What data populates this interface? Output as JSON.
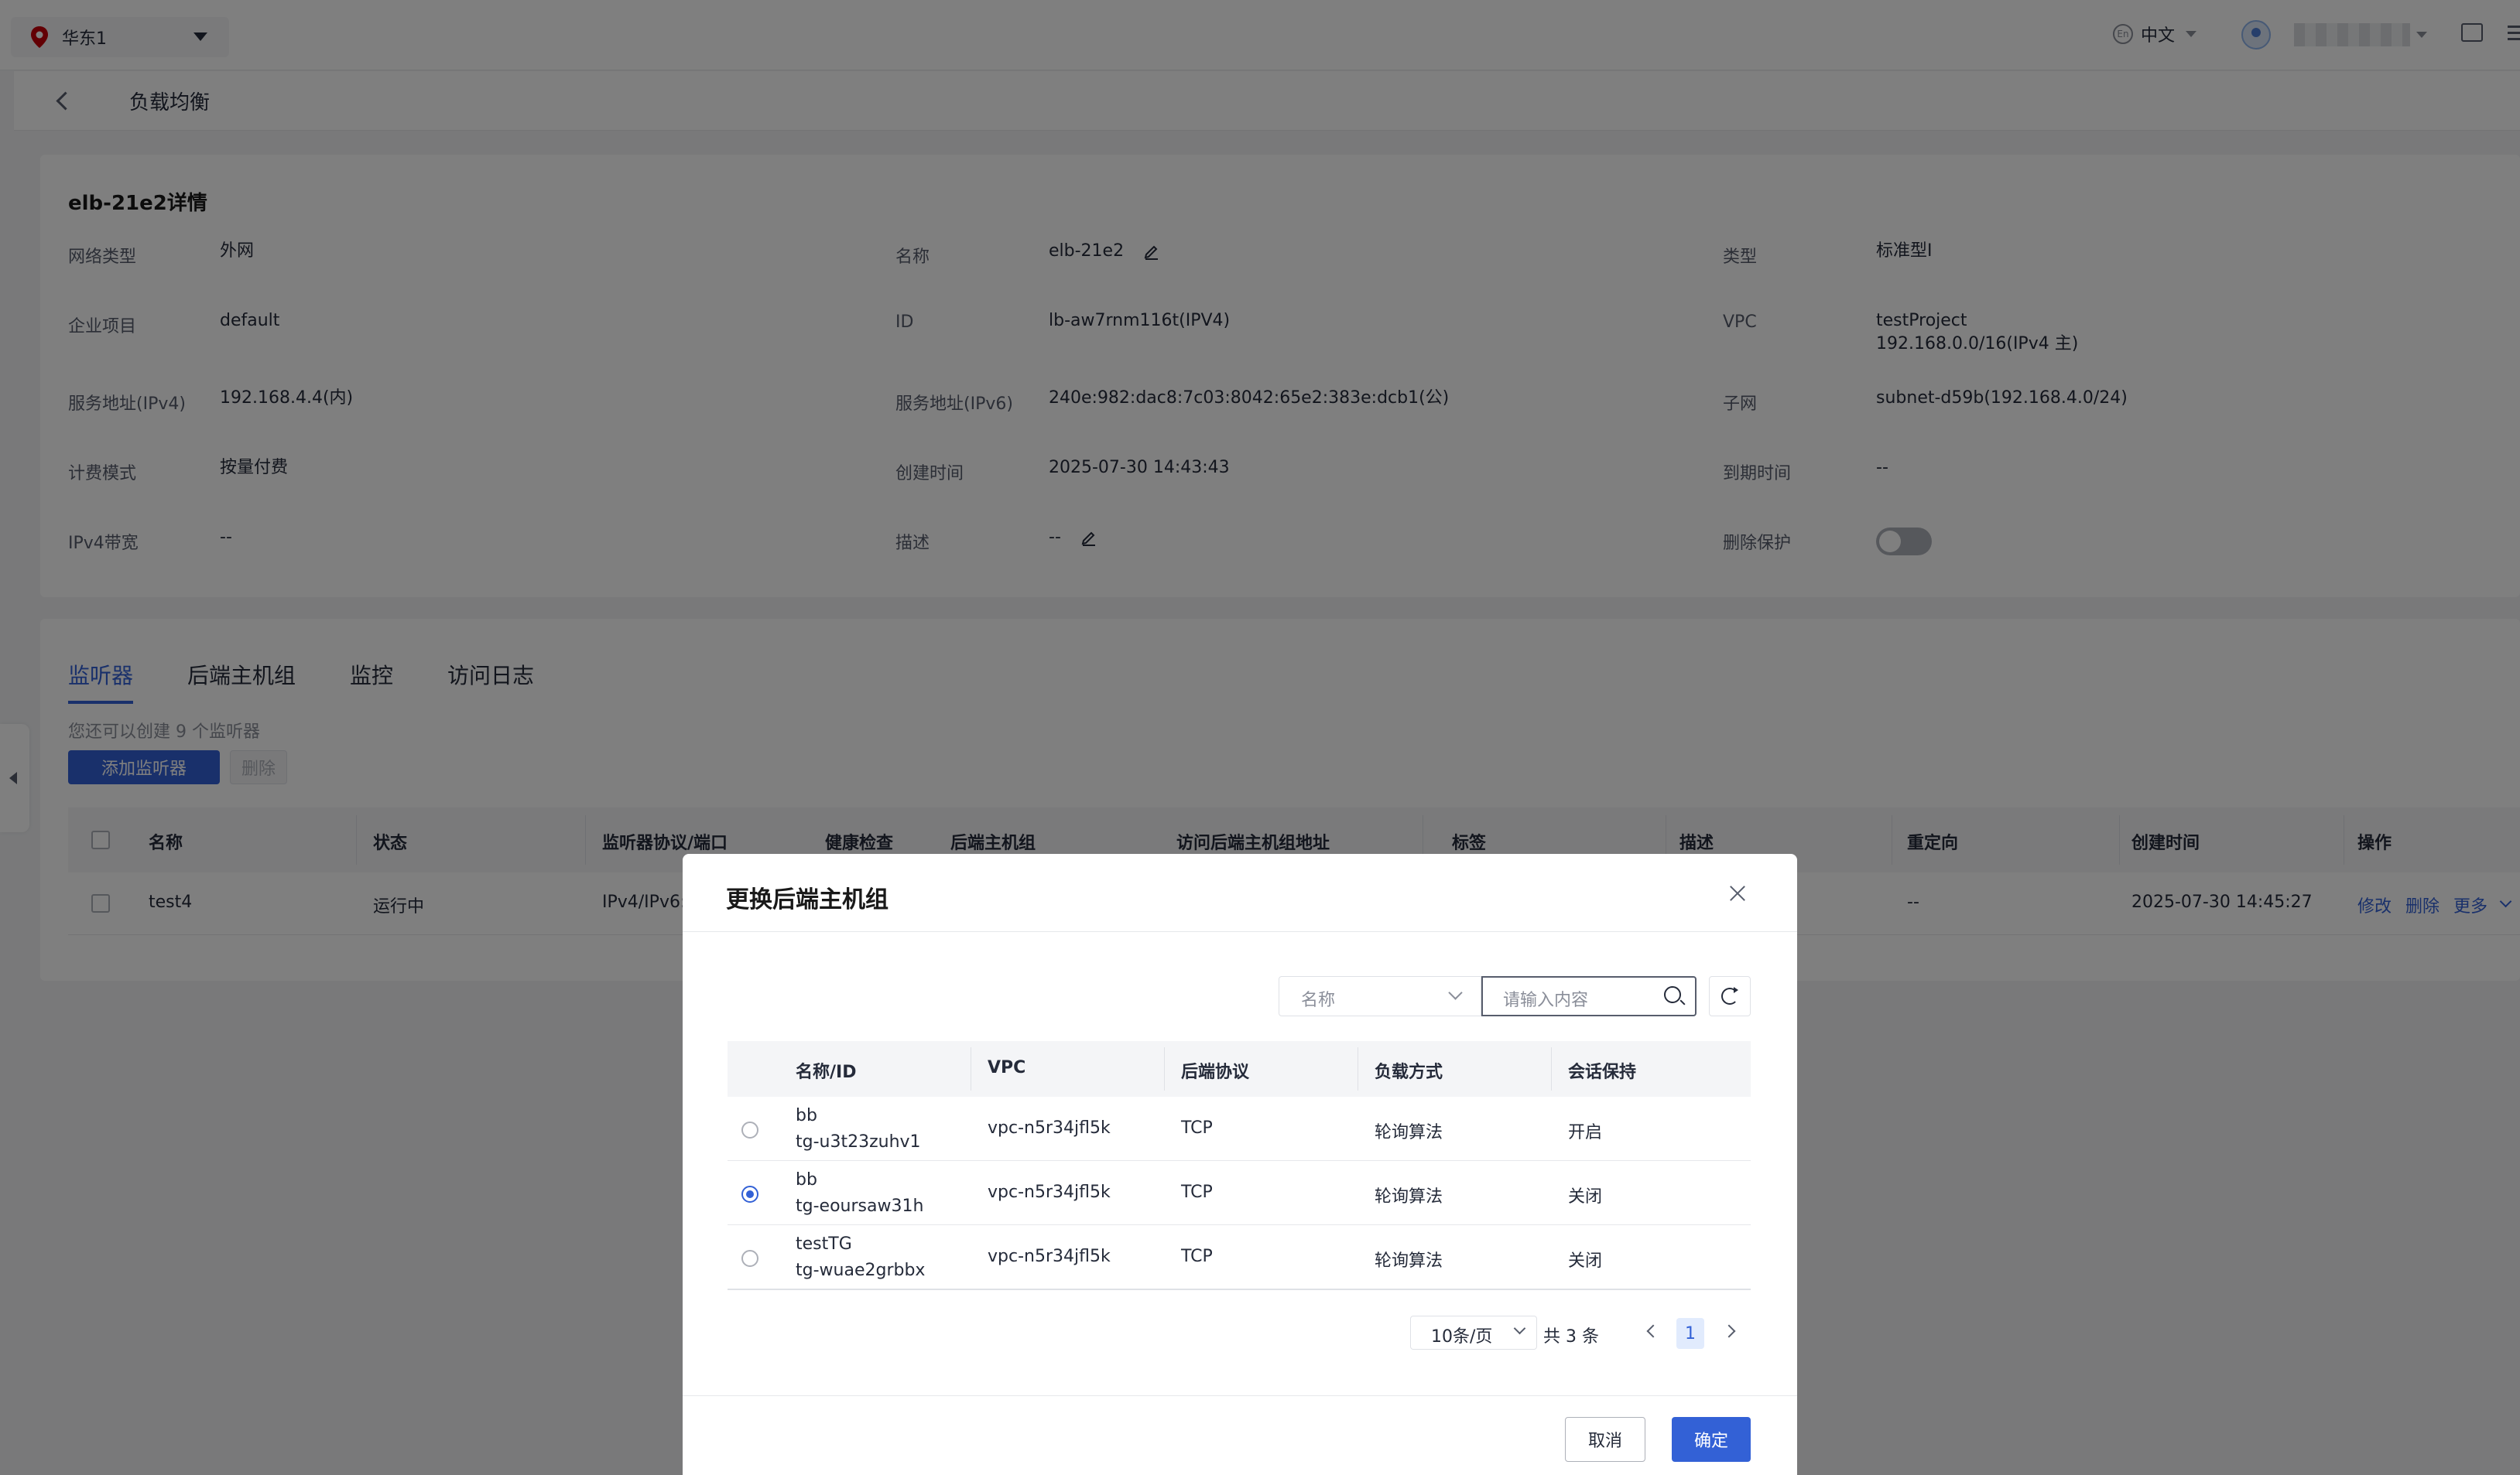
{
  "topbar": {
    "region": "华东1",
    "language": "中文",
    "lang_badge": "En"
  },
  "breadcrumb": {
    "title": "负载均衡"
  },
  "detail": {
    "title": "elb-21e2详情",
    "col1": [
      {
        "label": "网络类型",
        "value": "外网"
      },
      {
        "label": "企业项目",
        "value": "default"
      },
      {
        "label": "服务地址(IPv4)",
        "value": "192.168.4.4(内)"
      },
      {
        "label": "计费模式",
        "value": "按量付费"
      },
      {
        "label": "IPv4带宽",
        "value": "--"
      }
    ],
    "col2": [
      {
        "label": "名称",
        "value": "elb-21e2"
      },
      {
        "label": "ID",
        "value": "lb-aw7rnm116t(IPV4)"
      },
      {
        "label": "服务地址(IPv6)",
        "value": "240e:982:dac8:7c03:8042:65e2:383e:dcb1(公)"
      },
      {
        "label": "创建时间",
        "value": "2025-07-30 14:43:43"
      },
      {
        "label": "描述",
        "value": "--"
      }
    ],
    "col3": [
      {
        "label": "类型",
        "value": "标准型I"
      },
      {
        "label": "VPC",
        "value": "testProject",
        "value2": "192.168.0.0/16(IPv4 主)"
      },
      {
        "label": "子网",
        "value": "subnet-d59b(192.168.4.0/24)"
      },
      {
        "label": "到期时间",
        "value": "--"
      },
      {
        "label": "删除保护",
        "value": ""
      }
    ]
  },
  "listener": {
    "tabs": [
      "监听器",
      "后端主机组",
      "监控",
      "访问日志"
    ],
    "hint": "您还可以创建 9 个监听器",
    "add_button": "添加监听器",
    "delete_button": "删除",
    "columns": [
      "名称",
      "状态",
      "监听器协议/端口",
      "健康检查",
      "后端主机组",
      "访问后端主机组地址",
      "标签",
      "描述",
      "重定向",
      "创建时间",
      "操作"
    ],
    "row": {
      "name": "test4",
      "status": "运行中",
      "protocol": "IPv4/IPv6:",
      "redirect": "--",
      "created": "2025-07-30 14:45:27",
      "actions": [
        "修改",
        "删除",
        "更多"
      ]
    }
  },
  "modal": {
    "title": "更换后端主机组",
    "filter_field": "名称",
    "search_placeholder": "请输入内容",
    "columns": [
      "名称/ID",
      "VPC",
      "后端协议",
      "负载方式",
      "会话保持"
    ],
    "rows": [
      {
        "name": "bb",
        "id": "tg-u3t23zuhv1",
        "vpc": "vpc-n5r34jfl5k",
        "protocol": "TCP",
        "lb": "轮询算法",
        "session": "开启",
        "selected": false
      },
      {
        "name": "bb",
        "id": "tg-eoursaw31h",
        "vpc": "vpc-n5r34jfl5k",
        "protocol": "TCP",
        "lb": "轮询算法",
        "session": "关闭",
        "selected": true
      },
      {
        "name": "testTG",
        "id": "tg-wuae2grbbx",
        "vpc": "vpc-n5r34jfl5k",
        "protocol": "TCP",
        "lb": "轮询算法",
        "session": "关闭",
        "selected": false
      }
    ],
    "page_size": "10条/页",
    "total": "共 3 条",
    "page": "1",
    "cancel": "取消",
    "confirm": "确定"
  },
  "colors": {
    "primary": "#3361d6",
    "mask": "rgba(0,0,0,0.5)"
  }
}
